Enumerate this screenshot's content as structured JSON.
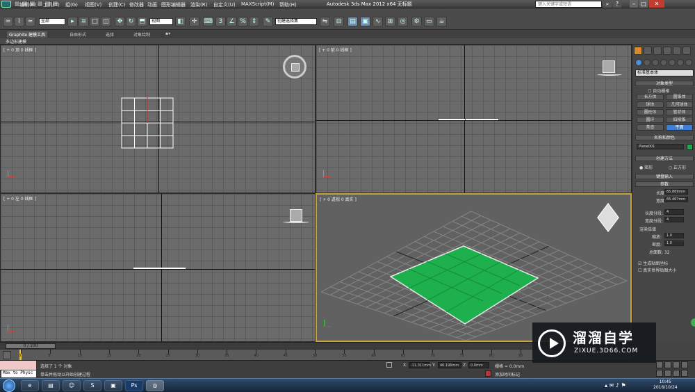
{
  "window": {
    "title": "Autodesk 3ds Max  2012 x64    无标题",
    "search_placeholder": "键入关键字或短语",
    "menus": [
      "编辑(E)",
      "工具(T)",
      "组(G)",
      "视图(V)",
      "创建(C)",
      "修改器",
      "动画",
      "图形编辑器",
      "渲染(R)",
      "自定义(U)",
      "MAXScript(M)",
      "帮助(H)"
    ]
  },
  "toolbar": {
    "selection_filter": "全部",
    "ref_coord": "视图",
    "named_selection": "创建选择集",
    "snap_value": "2.5",
    "percent_value": "%"
  },
  "ribbon": {
    "tabs": [
      "Graphite 建模工具",
      "自由形式",
      "选择",
      "对象绘制"
    ],
    "sub_label": "多边形建模"
  },
  "viewports": {
    "top": "[ + 0 顶 0 线框 ]",
    "front": "[ + 0 前 0 线框 ]",
    "left": "[ + 0 左 0 线框 ]",
    "perspective": "[ + 0 透视 0 真实 ]"
  },
  "command_panel": {
    "category": "标准基本体",
    "object_type_header": "对象类型",
    "autogrid": "自动栅格",
    "buttons": [
      "长方体",
      "圆锥体",
      "球体",
      "几何球体",
      "圆柱体",
      "管状体",
      "圆环",
      "四棱锥",
      "茶壶",
      "平面"
    ],
    "selected_button": "平面",
    "name_color_header": "名称和颜色",
    "object_name": "Plane001",
    "object_color": "#1fa84f",
    "creation_method_header": "创建方法",
    "creation_rect": "矩形",
    "creation_square": "正方形",
    "keyboard_entry_header": "键盘输入",
    "params_header": "参数",
    "length_label": "长度:",
    "length_value": "65.869mm",
    "width_label": "宽度:",
    "width_value": "65.467mm",
    "length_segs_label": "长度分段:",
    "length_segs": "4",
    "width_segs_label": "宽度分段:",
    "width_segs": "4",
    "render_multipliers": "渲染倍增",
    "scale_label": "缩放:",
    "scale_value": "1.0",
    "density_label": "密度:",
    "density_value": "1.0",
    "total_faces": "总面数: 32",
    "gen_mapping": "生成贴图坐标",
    "real_world": "真实世界贴图大小"
  },
  "timeline": {
    "frame_counter": "0 / 100",
    "ticks": [
      "0",
      "5",
      "10",
      "15",
      "20",
      "25",
      "30",
      "35",
      "40",
      "45",
      "50",
      "55",
      "60",
      "65",
      "70",
      "75",
      "80",
      "85"
    ]
  },
  "status": {
    "maxscript_label": "Max to Physc",
    "selected": "选择了 1 个 对象",
    "prompt": "单击并拖动以开始创建过程",
    "x_label": "X:",
    "x_value": "-11.311mm",
    "y_label": "Y:",
    "y_value": "46.196mm",
    "z_label": "Z:",
    "z_value": "0.0mm",
    "grid": "栅格 = 0.0mm",
    "add_time_tag": "添加时间标记"
  },
  "taskbar": {
    "time": "10:45",
    "date": "2016/10/24",
    "apps": [
      "ie-icon",
      "folder-icon",
      "qq-icon",
      "sogou-icon",
      "photo-icon",
      "photoshop-icon",
      "3dsmax-icon"
    ]
  },
  "watermark": {
    "title": "溜溜自学",
    "url": "ZIXUE.3D66.COM"
  }
}
